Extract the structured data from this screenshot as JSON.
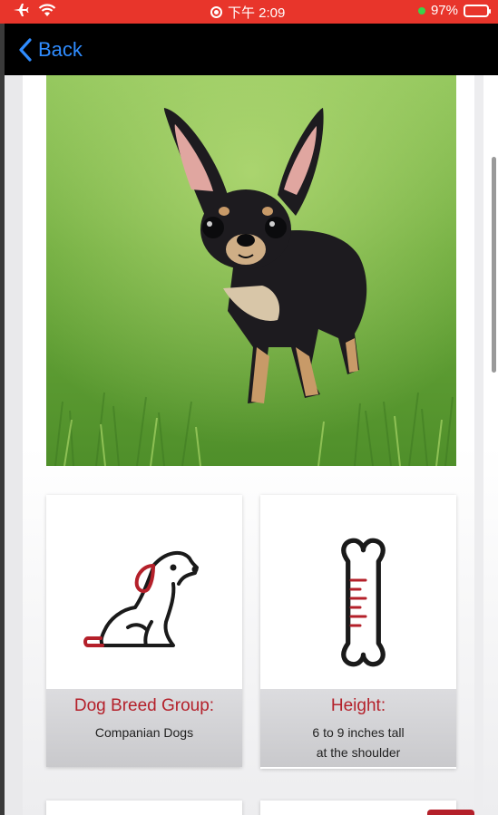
{
  "status_bar": {
    "time": "下午 2:09",
    "battery_percent": "97%",
    "battery_level": 0.97
  },
  "nav": {
    "back_label": "Back"
  },
  "cards": [
    {
      "icon": "sitting-dog-icon",
      "title": "Dog Breed Group:",
      "lines": [
        "Companian Dogs"
      ]
    },
    {
      "icon": "bone-ruler-icon",
      "title": "Height:",
      "lines": [
        "6 to 9 inches tall",
        "at the shoulder"
      ]
    }
  ],
  "colors": {
    "status_bar": "#e8352b",
    "nav_bar": "#000000",
    "accent_blue": "#2f8cff",
    "accent_red": "#b4202a"
  }
}
